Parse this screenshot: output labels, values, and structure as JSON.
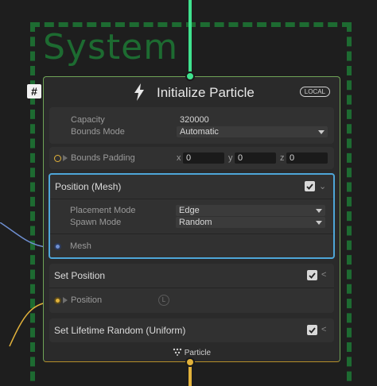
{
  "system": {
    "title": "System"
  },
  "node": {
    "badge": "#",
    "title": "Initialize Particle",
    "space_badge": "LOCAL",
    "footer": "Particle"
  },
  "settings": {
    "capacity_label": "Capacity",
    "capacity_value": "320000",
    "bounds_mode_label": "Bounds Mode",
    "bounds_mode_value": "Automatic",
    "bounds_padding_label": "Bounds Padding",
    "x_label": "x",
    "x_value": "0",
    "y_label": "y",
    "y_value": "0",
    "z_label": "z",
    "z_value": "0"
  },
  "blocks": {
    "position_mesh": {
      "title": "Position (Mesh)",
      "placement_label": "Placement Mode",
      "placement_value": "Edge",
      "spawn_label": "Spawn Mode",
      "spawn_value": "Random",
      "mesh_label": "Mesh"
    },
    "set_position": {
      "title": "Set Position",
      "position_label": "Position",
      "space_tag": "L"
    },
    "set_lifetime": {
      "title": "Set Lifetime Random (Uniform)"
    }
  },
  "colors": {
    "system_frame": "#1d6b31",
    "flow_in": "#3fe28e",
    "flow_out": "#e2b23b",
    "selection": "#4ea6d8",
    "mesh_link": "#6f8fd1"
  }
}
